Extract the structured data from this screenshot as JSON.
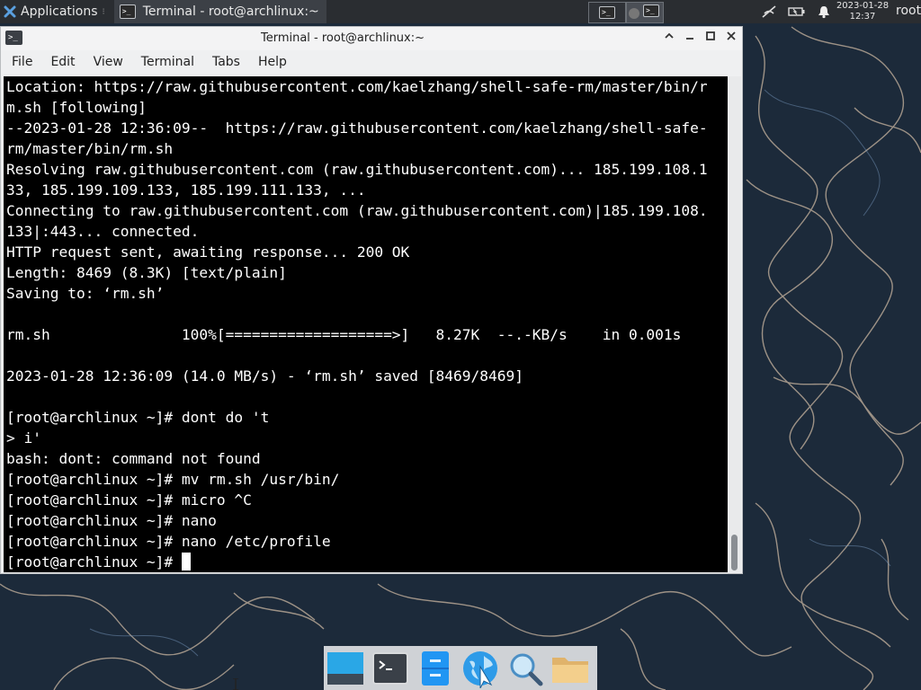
{
  "panel": {
    "applications_label": "Applications",
    "task_title": "Terminal - root@archlinux:~",
    "clock_date": "2023-01-28",
    "clock_time": "12:37",
    "user": "root"
  },
  "window": {
    "title": "Terminal - root@archlinux:~",
    "menu": [
      "File",
      "Edit",
      "View",
      "Terminal",
      "Tabs",
      "Help"
    ]
  },
  "terminal_lines": [
    "Location: https://raw.githubusercontent.com/kaelzhang/shell-safe-rm/master/bin/r",
    "m.sh [following]",
    "--2023-01-28 12:36:09--  https://raw.githubusercontent.com/kaelzhang/shell-safe-",
    "rm/master/bin/rm.sh",
    "Resolving raw.githubusercontent.com (raw.githubusercontent.com)... 185.199.108.1",
    "33, 185.199.109.133, 185.199.111.133, ...",
    "Connecting to raw.githubusercontent.com (raw.githubusercontent.com)|185.199.108.",
    "133|:443... connected.",
    "HTTP request sent, awaiting response... 200 OK",
    "Length: 8469 (8.3K) [text/plain]",
    "Saving to: ‘rm.sh’",
    "",
    "rm.sh               100%[===================>]   8.27K  --.-KB/s    in 0.001s",
    "",
    "2023-01-28 12:36:09 (14.0 MB/s) - ‘rm.sh’ saved [8469/8469]",
    "",
    "[root@archlinux ~]# dont do 't",
    "> i'",
    "bash: dont: command not found",
    "[root@archlinux ~]# mv rm.sh /usr/bin/",
    "[root@archlinux ~]# micro ^C",
    "[root@archlinux ~]# nano",
    "[root@archlinux ~]# nano /etc/profile",
    "[root@archlinux ~]# "
  ],
  "icons": {
    "apps": "xfce-mouse-icon",
    "tray": [
      "network-disconnected-icon",
      "battery-icon",
      "notification-bell-icon"
    ],
    "dock": [
      "show-desktop-icon",
      "terminal-icon",
      "file-cabinet-icon",
      "web-browser-icon",
      "app-finder-icon",
      "folder-icon"
    ]
  },
  "colors": {
    "panel_bg": "#2a2d31",
    "terminal_bg": "#000000",
    "terminal_fg": "#ffffff",
    "wallpaper_bg": "#1c2a3a"
  }
}
